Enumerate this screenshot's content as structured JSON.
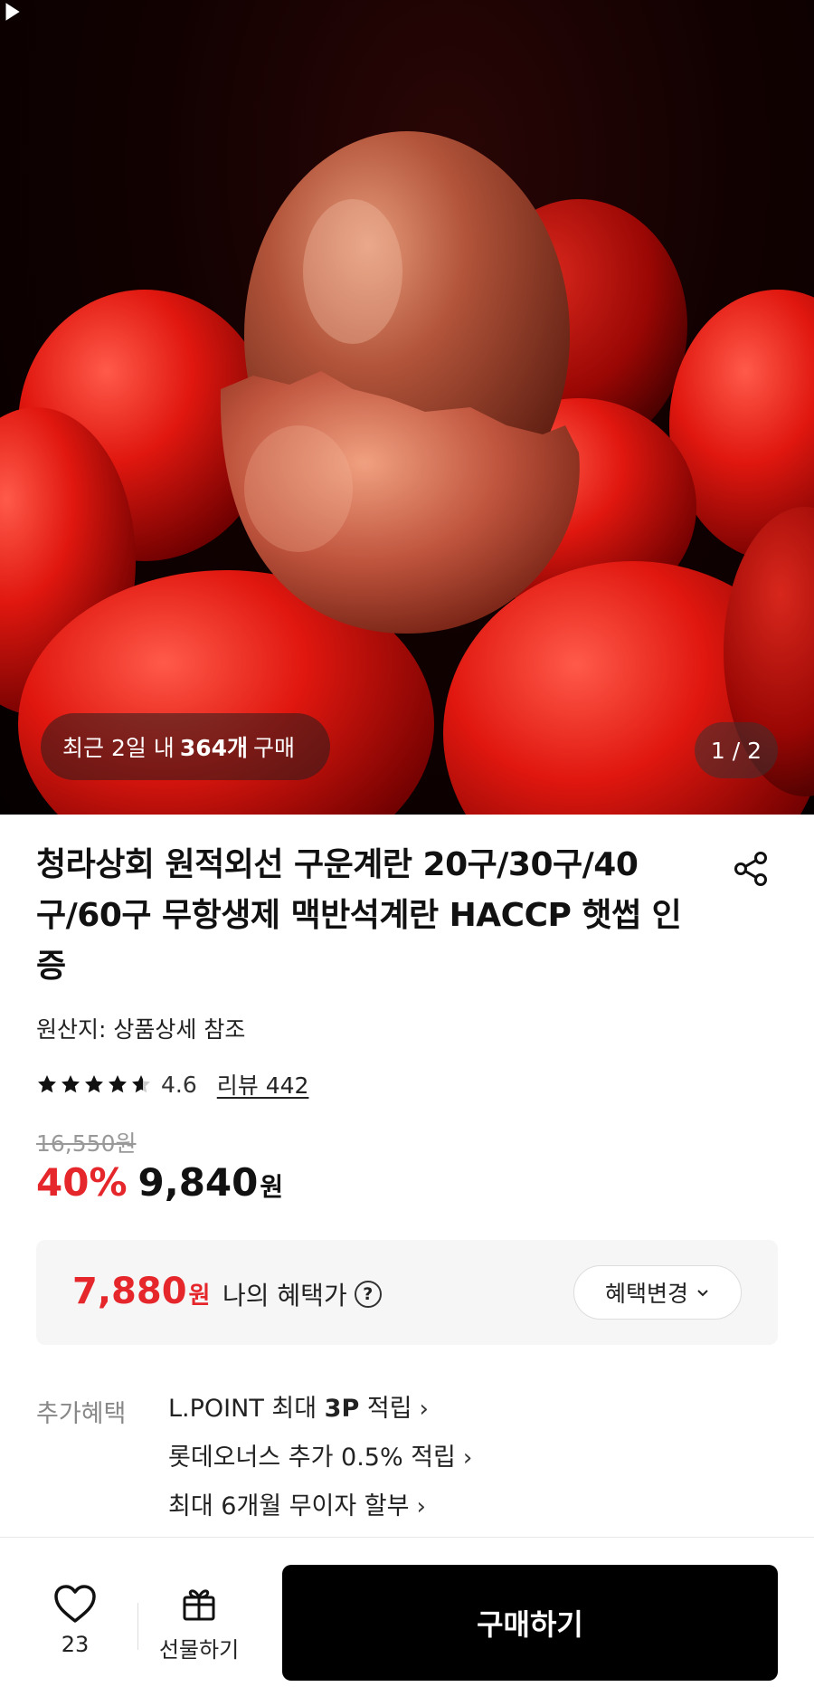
{
  "hero": {
    "recent_prefix": "최근 2일 내",
    "recent_count": "364개",
    "recent_suffix": "구매",
    "pager": "1 / 2"
  },
  "product": {
    "title": "청라상회 원적외선 구운계란 20구/30구/40구/60구 무항생제 맥반석계란 HACCP 햇썹 인증",
    "origin": "원산지: 상품상세 참조",
    "rating": "4.6",
    "rating_stars": 4.6,
    "review_label": "리뷰 442",
    "original_price": "16,550원",
    "discount": "40%",
    "price": "9,840",
    "currency": "원"
  },
  "benefit": {
    "price": "7,880",
    "currency": "원",
    "label": "나의 혜택가",
    "help_icon": "question-circle-icon",
    "change_label": "혜택변경"
  },
  "extra": {
    "label": "추가혜택",
    "items": [
      {
        "prefix": "L.POINT 최대 ",
        "bold": "3P",
        "suffix": " 적립"
      },
      {
        "prefix": "롯데오너스 추가 0.5% 적립",
        "bold": "",
        "suffix": ""
      },
      {
        "prefix": "최대 6개월 무이자 할부",
        "bold": "",
        "suffix": ""
      }
    ]
  },
  "bottom": {
    "like_count": "23",
    "gift_label": "선물하기",
    "buy_label": "구매하기"
  },
  "colors": {
    "accent_red": "#e5262b",
    "buy_button": "#000000"
  }
}
